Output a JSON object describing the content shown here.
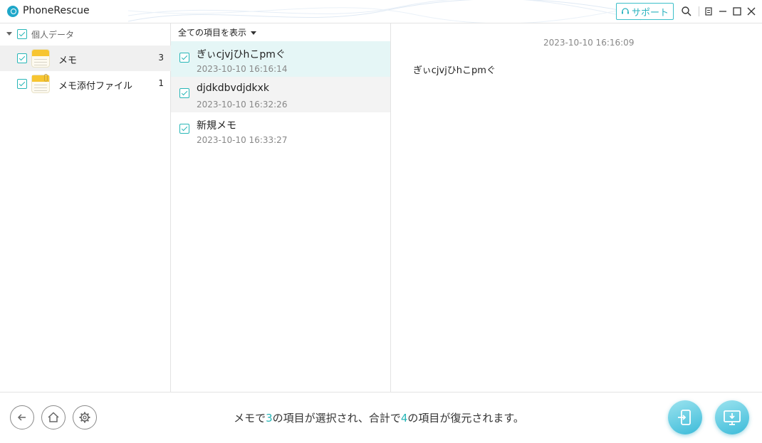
{
  "app": {
    "title": "PhoneRescue"
  },
  "titlebar": {
    "support_label": "サポート"
  },
  "left_panel": {
    "category": {
      "label": "個人データ"
    },
    "items": [
      {
        "label": "メモ",
        "count": "3"
      },
      {
        "label": "メモ添付ファイル",
        "count": "1"
      }
    ]
  },
  "middle_panel": {
    "filter_label": "全ての項目を表示",
    "items": [
      {
        "title": "ぎぃcjvjひhこpmぐ",
        "time": "2023-10-10 16:16:14"
      },
      {
        "title": "djdkdbvdjdkxk",
        "time": "2023-10-10 16:32:26"
      },
      {
        "title": "新規メモ",
        "time": "2023-10-10 16:33:27"
      }
    ]
  },
  "detail": {
    "timestamp": "2023-10-10 16:16:09",
    "body": "ぎぃcjvjひhこpmぐ"
  },
  "bottom": {
    "status_part1": "メモで",
    "selected_count": "3",
    "status_part2": "の項目が選択され、合計で",
    "total_count": "4",
    "status_part3": "の項目が復元されます。"
  },
  "colors": {
    "accent": "#27b6b7",
    "button_gradient_start": "#9be3ef",
    "button_gradient_end": "#3cbbd9"
  }
}
